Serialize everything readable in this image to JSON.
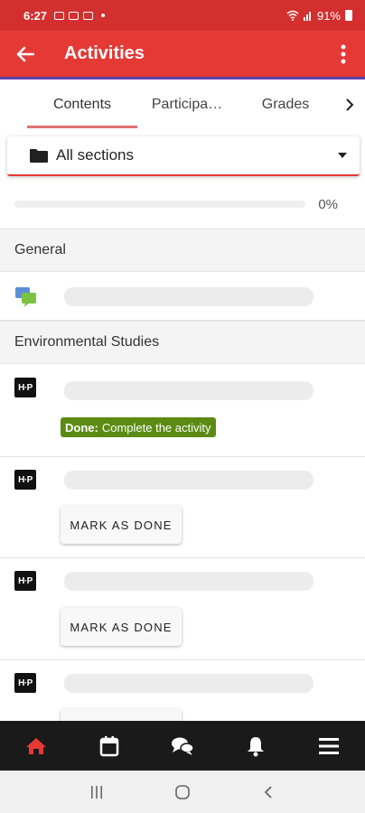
{
  "status_bar": {
    "time": "6:27",
    "battery": "91%",
    "bg_color": "#d32f2f"
  },
  "app_bar": {
    "title": "Activities",
    "back_icon": "arrow-left-icon",
    "menu_icon": "more-vertical-icon",
    "bg_color": "#e53935"
  },
  "tabs": {
    "items": [
      {
        "label": "Contents",
        "active": true
      },
      {
        "label": "Participa…",
        "active": false
      },
      {
        "label": "Grades",
        "active": false
      }
    ],
    "next_icon": "chevron-right-icon"
  },
  "section_select": {
    "icon": "folder-icon",
    "value": "All sections"
  },
  "progress": {
    "value": 0,
    "label": "0%"
  },
  "sections": [
    {
      "title": "General",
      "activities": [
        {
          "icon": "forum-icon",
          "name_loading": true
        }
      ]
    },
    {
      "title": "Environmental Studies",
      "activities": [
        {
          "icon": "h5p-icon",
          "icon_text": "H·P",
          "name_loading": true,
          "completion_badge": {
            "label": "Done:",
            "text": "Complete the activity"
          }
        },
        {
          "icon": "h5p-icon",
          "icon_text": "H·P",
          "name_loading": true,
          "button": "MARK AS DONE"
        },
        {
          "icon": "h5p-icon",
          "icon_text": "H·P",
          "name_loading": true,
          "button": "MARK AS DONE"
        },
        {
          "icon": "h5p-icon",
          "icon_text": "H·P",
          "name_loading": true
        }
      ]
    }
  ],
  "bottom_nav": [
    {
      "icon": "home-icon",
      "active": true
    },
    {
      "icon": "calendar-icon",
      "active": false
    },
    {
      "icon": "messages-icon",
      "active": false
    },
    {
      "icon": "bell-icon",
      "active": false
    },
    {
      "icon": "menu-icon",
      "active": false
    }
  ],
  "system_nav": [
    {
      "icon": "recents-icon"
    },
    {
      "icon": "home-circle-icon"
    },
    {
      "icon": "back-icon"
    }
  ],
  "colors": {
    "accent": "#e53935",
    "done_badge": "#5b8b12",
    "bottom_nav_bg": "#1a1a1a"
  }
}
